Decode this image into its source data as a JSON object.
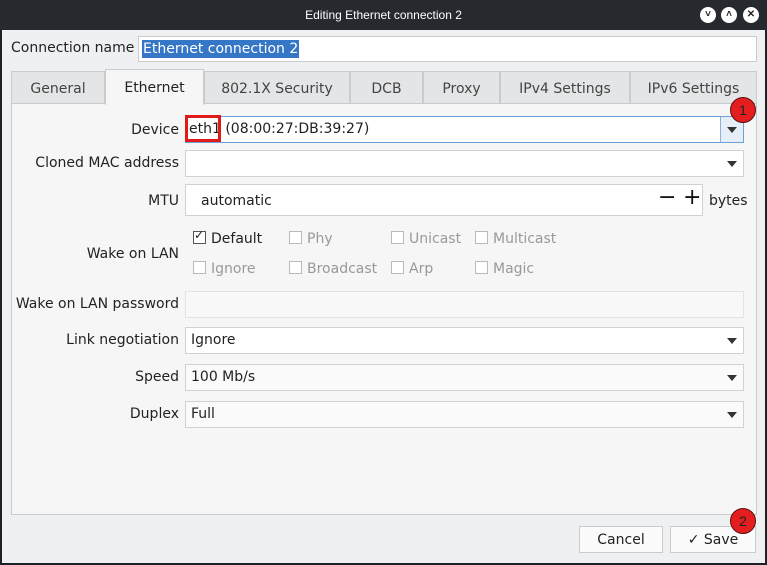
{
  "window": {
    "title": "Editing Ethernet connection 2",
    "controls": [
      "˅",
      "˄",
      "✕"
    ]
  },
  "connection": {
    "label": "Connection name",
    "value": "Ethernet connection 2"
  },
  "tabs": [
    {
      "label": "General"
    },
    {
      "label": "Ethernet",
      "active": true
    },
    {
      "label": "802.1X Security"
    },
    {
      "label": "DCB"
    },
    {
      "label": "Proxy"
    },
    {
      "label": "IPv4 Settings"
    },
    {
      "label": "IPv6 Settings"
    }
  ],
  "ethernet": {
    "device_label": "Device",
    "device_name": "eth1",
    "device_mac": "(08:00:27:DB:39:27)",
    "cloned_mac_label": "Cloned MAC address",
    "cloned_mac_value": "",
    "mtu_label": "MTU",
    "mtu_value": "automatic",
    "mtu_unit": "bytes",
    "mtu_minus": "−",
    "mtu_plus": "+",
    "wol_label": "Wake on LAN",
    "wol_options": [
      {
        "label": "Default",
        "checked": true,
        "enabled": true
      },
      {
        "label": "Phy",
        "checked": false,
        "enabled": false
      },
      {
        "label": "Unicast",
        "checked": false,
        "enabled": false
      },
      {
        "label": "Multicast",
        "checked": false,
        "enabled": false
      },
      {
        "label": "Ignore",
        "checked": false,
        "enabled": false
      },
      {
        "label": "Broadcast",
        "checked": false,
        "enabled": false
      },
      {
        "label": "Arp",
        "checked": false,
        "enabled": false
      },
      {
        "label": "Magic",
        "checked": false,
        "enabled": false
      }
    ],
    "wol_password_label": "Wake on LAN password",
    "wol_password_value": "",
    "link_negotiation_label": "Link negotiation",
    "link_negotiation_value": "Ignore",
    "speed_label": "Speed",
    "speed_value": "100 Mb/s",
    "duplex_label": "Duplex",
    "duplex_value": "Full"
  },
  "buttons": {
    "cancel": "Cancel",
    "save": "Save",
    "save_icon": "✓"
  },
  "annotations": [
    {
      "number": "1"
    },
    {
      "number": "2"
    }
  ],
  "colors": {
    "selection": "#3577c6",
    "annotation": "#e41e1e",
    "titlebar": "#262a2f"
  }
}
